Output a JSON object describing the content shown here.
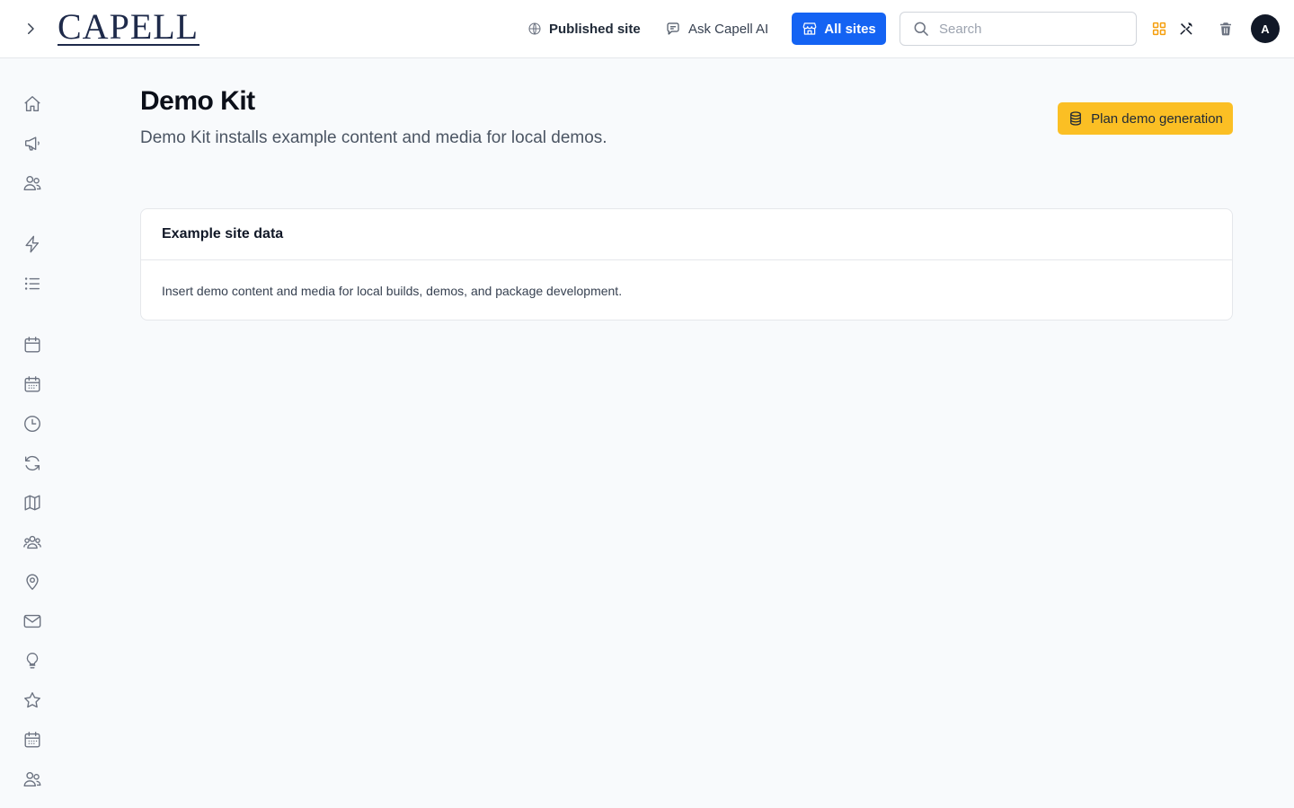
{
  "app": {
    "logo_text": "CAPELL"
  },
  "header": {
    "published_site_label": "Published site",
    "ask_ai_label": "Ask Capell AI",
    "all_sites_label": "All sites",
    "search_placeholder": "Search",
    "search_value": "",
    "avatar_initial": "A"
  },
  "sidebar": {
    "items": [
      {
        "icon": "home-icon"
      },
      {
        "icon": "megaphone-icon"
      },
      {
        "icon": "users-icon"
      },
      {
        "icon": "bolt-icon"
      },
      {
        "icon": "list-icon"
      },
      {
        "icon": "calendar-icon"
      },
      {
        "icon": "calendar-days-icon"
      },
      {
        "icon": "clock-icon"
      },
      {
        "icon": "refresh-icon"
      },
      {
        "icon": "map-icon"
      },
      {
        "icon": "user-group-icon"
      },
      {
        "icon": "map-pin-icon"
      },
      {
        "icon": "envelope-icon"
      },
      {
        "icon": "light-bulb-icon"
      },
      {
        "icon": "star-icon"
      },
      {
        "icon": "calendar-days-icon"
      },
      {
        "icon": "users-icon"
      }
    ]
  },
  "page": {
    "title": "Demo Kit",
    "subtitle": "Demo Kit installs example content and media for local demos.",
    "action_label": "Plan demo generation"
  },
  "card": {
    "title": "Example site data",
    "description": "Insert demo content and media for local builds, demos, and package development."
  },
  "colors": {
    "primary": "#1463f3",
    "warning": "#fbbf24",
    "accent_orange": "#f59e0b",
    "avatar_bg": "#111827",
    "logo_navy": "#1e2a4a"
  }
}
